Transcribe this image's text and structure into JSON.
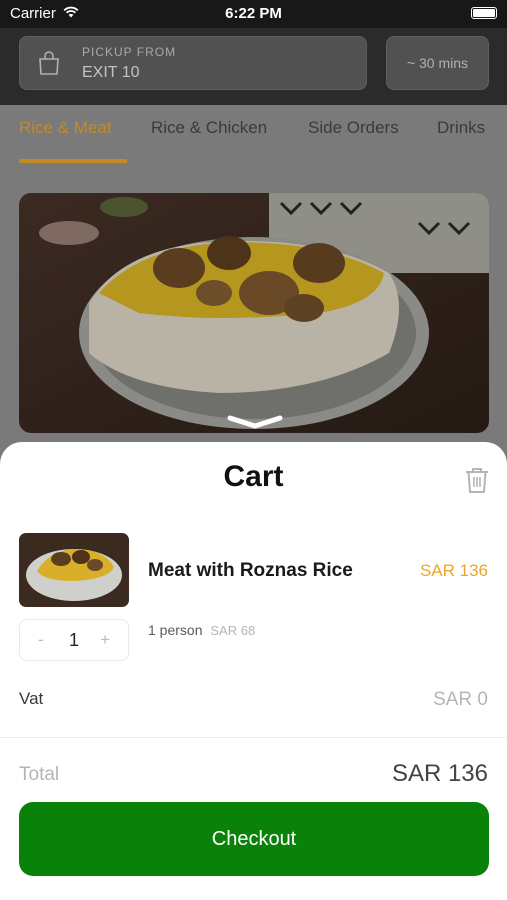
{
  "status_bar": {
    "carrier": "Carrier",
    "time": "6:22 PM"
  },
  "header": {
    "pickup_label": "PICKUP FROM",
    "pickup_value": "EXIT 10",
    "eta": "~ 30 mins"
  },
  "tabs": [
    {
      "label": "Rice & Meat",
      "active": true
    },
    {
      "label": "Rice & Chicken",
      "active": false
    },
    {
      "label": "Side Orders",
      "active": false
    },
    {
      "label": "Drinks",
      "active": false
    }
  ],
  "cart": {
    "title": "Cart",
    "item": {
      "name": "Meat with Roznas Rice",
      "price": "SAR 136",
      "quantity": "1",
      "minus": "-",
      "plus": "+",
      "persons": "1 person",
      "unit_price": "SAR 68"
    },
    "vat_label": "Vat",
    "vat_value": "SAR 0",
    "total_label": "Total",
    "total_value": "SAR 136",
    "checkout_label": "Checkout"
  },
  "colors": {
    "accent": "#eaa62c",
    "tab_active": "#c48a24",
    "checkout": "#0a820a"
  }
}
